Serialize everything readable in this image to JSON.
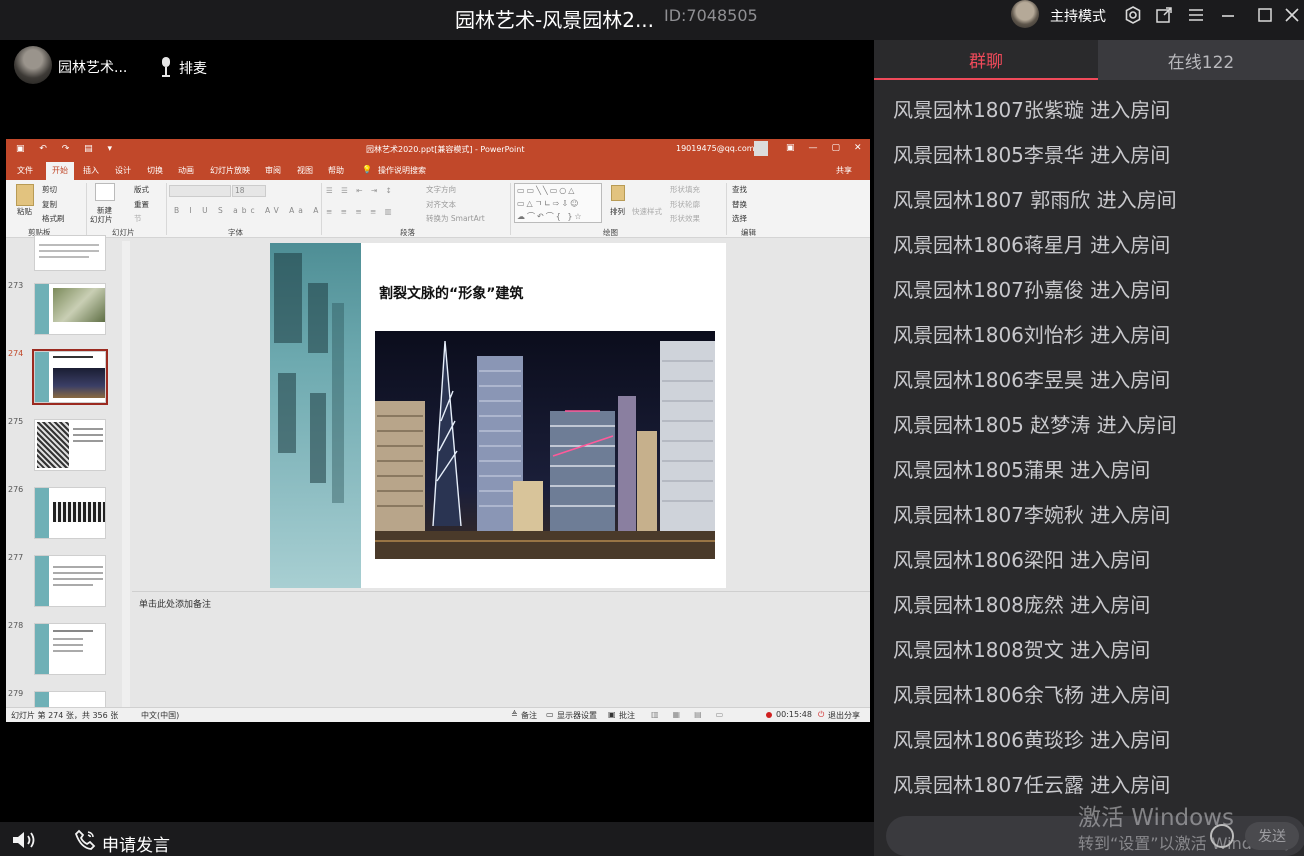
{
  "window": {
    "title": "园林艺术-风景园林2...",
    "room_id": "ID:7048505",
    "host_mode_label": "主持模式",
    "icons": [
      "settings-icon",
      "popout-icon",
      "menu-icon",
      "minimize-icon",
      "maximize-icon",
      "close-icon"
    ]
  },
  "presenter": {
    "name": "园林艺术...",
    "mic_queue_label": "排麦"
  },
  "ppt": {
    "doc_title": "园林艺术2020.ppt[兼容模式] - PowerPoint",
    "account": "19019475@qq.com",
    "tabs": [
      "文件",
      "开始",
      "插入",
      "设计",
      "切换",
      "动画",
      "幻灯片放映",
      "审阅",
      "视图",
      "帮助",
      "操作说明搜索"
    ],
    "share_label": "共享",
    "ribbon": {
      "paste": "粘贴",
      "cut": "剪切",
      "copy": "复制",
      "format_painter": "格式刷",
      "new_slide": "新建",
      "new_slide2": "幻灯片",
      "layout": "版式",
      "reset": "重置",
      "section": "节",
      "font_size": "18",
      "text_direction": "文字方向",
      "align_text": "对齐文本",
      "smartart": "转换为 SmartArt",
      "arrange": "排列",
      "quick_styles": "快速样式",
      "shape_fill": "形状填充",
      "shape_outline": "形状轮廓",
      "shape_effects": "形状效果",
      "find": "查找",
      "replace": "替换",
      "select": "选择",
      "groups": [
        "剪贴板",
        "幻灯片",
        "字体",
        "段落",
        "绘图",
        "编辑"
      ]
    },
    "thumb_numbers": [
      "273",
      "274",
      "275",
      "276",
      "277",
      "278",
      "279"
    ],
    "slide": {
      "heading": "割裂文脉的“形象”建筑"
    },
    "notes_placeholder": "单击此处添加备注",
    "status": {
      "slide_info": "幻灯片 第 274 张，共 356 张",
      "language": "中文(中国)",
      "notes": "备注",
      "display_settings": "显示器设置",
      "comments": "批注",
      "timer": "00:15:48",
      "exit_share": "退出分享"
    }
  },
  "bottom": {
    "apply_speak_label": "申请发言"
  },
  "chat": {
    "tab_group": "群聊",
    "tab_online": "在线122",
    "messages": [
      "风景园林1807张紫璇 进入房间",
      "风景园林1805李景华 进入房间",
      "风景园林1807 郭雨欣 进入房间",
      "风景园林1806蒋星月 进入房间",
      "风景园林1807孙嘉俊 进入房间",
      "风景园林1806刘怡杉 进入房间",
      "风景园林1806李昱昊 进入房间",
      "风景园林1805 赵梦涛 进入房间",
      "风景园林1805蒲果 进入房间",
      "风景园林1807李婉秋 进入房间",
      "风景园林1806梁阳 进入房间",
      "风景园林1808庞然 进入房间",
      "风景园林1808贺文 进入房间",
      "风景园林1806余飞杨 进入房间",
      "风景园林1806黄琰珍 进入房间",
      "风景园林1807任云露 进入房间"
    ],
    "send_label": "发送"
  },
  "watermark": {
    "line1": "激活 Windows",
    "line2": "转到“设置”以激活 Windows。"
  }
}
